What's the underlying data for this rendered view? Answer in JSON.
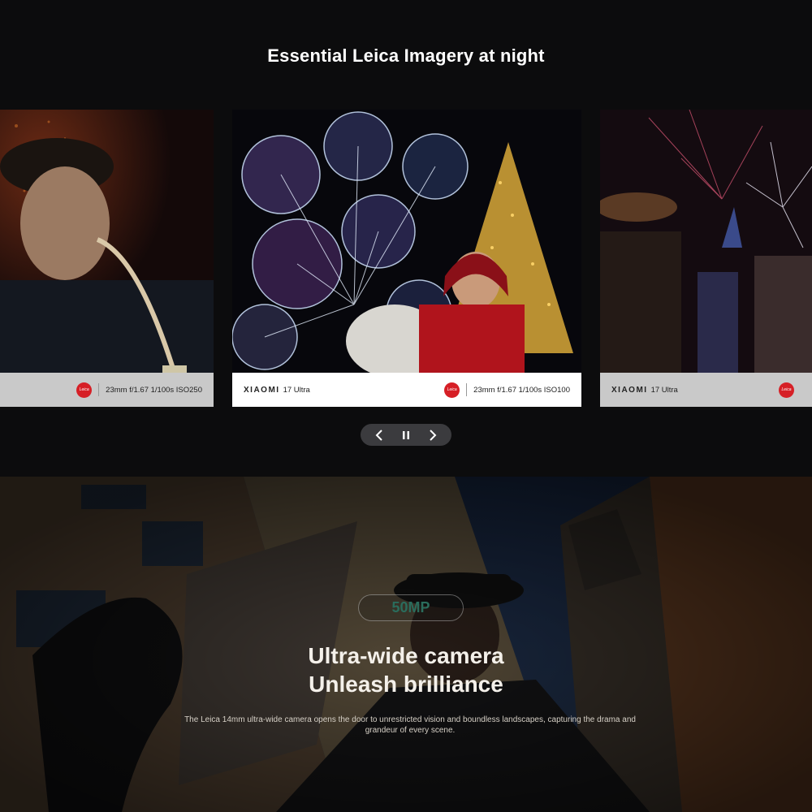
{
  "section_title": "Essential Leica Imagery at night",
  "slides": [
    {
      "brand": "",
      "model": "",
      "specs": "23mm  f/1.67  1/100s  ISO250",
      "logo": "Leica"
    },
    {
      "brand": "XIAOMI",
      "model": "17 Ultra",
      "specs": "23mm  f/1.67  1/100s  ISO100",
      "logo": "Leica"
    },
    {
      "brand": "XIAOMI",
      "model": "17 Ultra",
      "specs": "",
      "logo": "Leica"
    }
  ],
  "controls": {
    "prev": "chevron-left-icon",
    "pause": "pause-icon",
    "next": "chevron-right-icon"
  },
  "feature": {
    "badge": "50MP",
    "headline_1": "Ultra-wide camera",
    "headline_2": "Unleash brilliance",
    "description": "The Leica 14mm ultra-wide camera opens the door to unrestricted vision and boundless landscapes, capturing the drama and grandeur of every scene."
  },
  "colors": {
    "background": "#0c0c0d",
    "leica_red": "#d61f26",
    "badge_text": "#2a6c5c",
    "controls_bg": "#3b3b3e"
  }
}
